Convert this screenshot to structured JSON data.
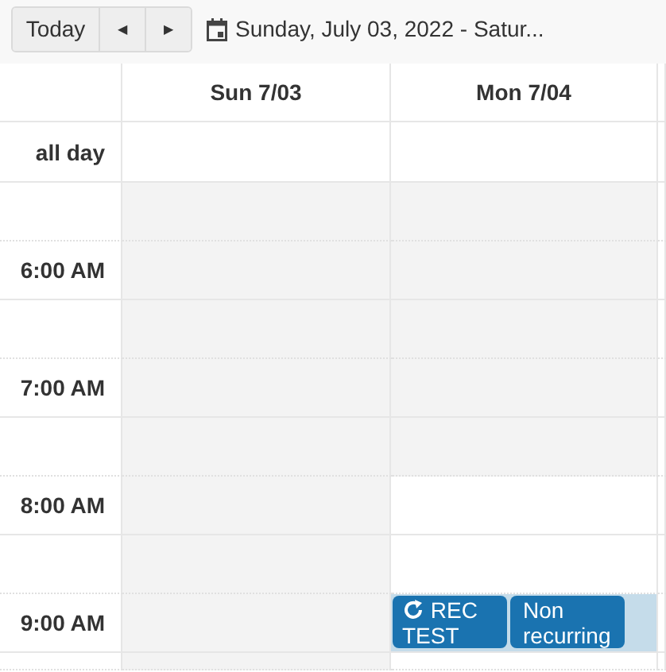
{
  "toolbar": {
    "today": "Today",
    "prev": "◀",
    "next": "▶",
    "range": "Sunday, July 03, 2022 - Satur..."
  },
  "days": [
    "Sun 7/03",
    "Mon 7/04"
  ],
  "all_day_label": "all day",
  "slots": [
    {
      "cells": [
        {
          "nonworking": true,
          "selected": false
        },
        {
          "nonworking": true,
          "selected": false
        }
      ]
    },
    {
      "time": "6:00 AM",
      "cells": [
        {
          "nonworking": true,
          "selected": false
        },
        {
          "nonworking": true,
          "selected": false
        }
      ]
    },
    {
      "cells": [
        {
          "nonworking": true,
          "selected": false
        },
        {
          "nonworking": true,
          "selected": false
        }
      ]
    },
    {
      "time": "7:00 AM",
      "cells": [
        {
          "nonworking": true,
          "selected": false
        },
        {
          "nonworking": true,
          "selected": false
        }
      ]
    },
    {
      "cells": [
        {
          "nonworking": true,
          "selected": false
        },
        {
          "nonworking": true,
          "selected": false
        }
      ]
    },
    {
      "time": "8:00 AM",
      "cells": [
        {
          "nonworking": true,
          "selected": false
        },
        {
          "nonworking": false,
          "selected": false
        }
      ]
    },
    {
      "cells": [
        {
          "nonworking": true,
          "selected": false
        },
        {
          "nonworking": false,
          "selected": false
        }
      ]
    },
    {
      "time": "9:00 AM",
      "cells": [
        {
          "nonworking": true,
          "selected": false
        },
        {
          "nonworking": false,
          "selected": true,
          "events": [
            {
              "title": "REC TEST",
              "recurring": true
            },
            {
              "title": "Non recurring",
              "recurring": false
            }
          ]
        }
      ]
    },
    {
      "cells": [
        {
          "nonworking": true,
          "selected": false
        },
        {
          "nonworking": false,
          "selected": false
        }
      ]
    }
  ]
}
